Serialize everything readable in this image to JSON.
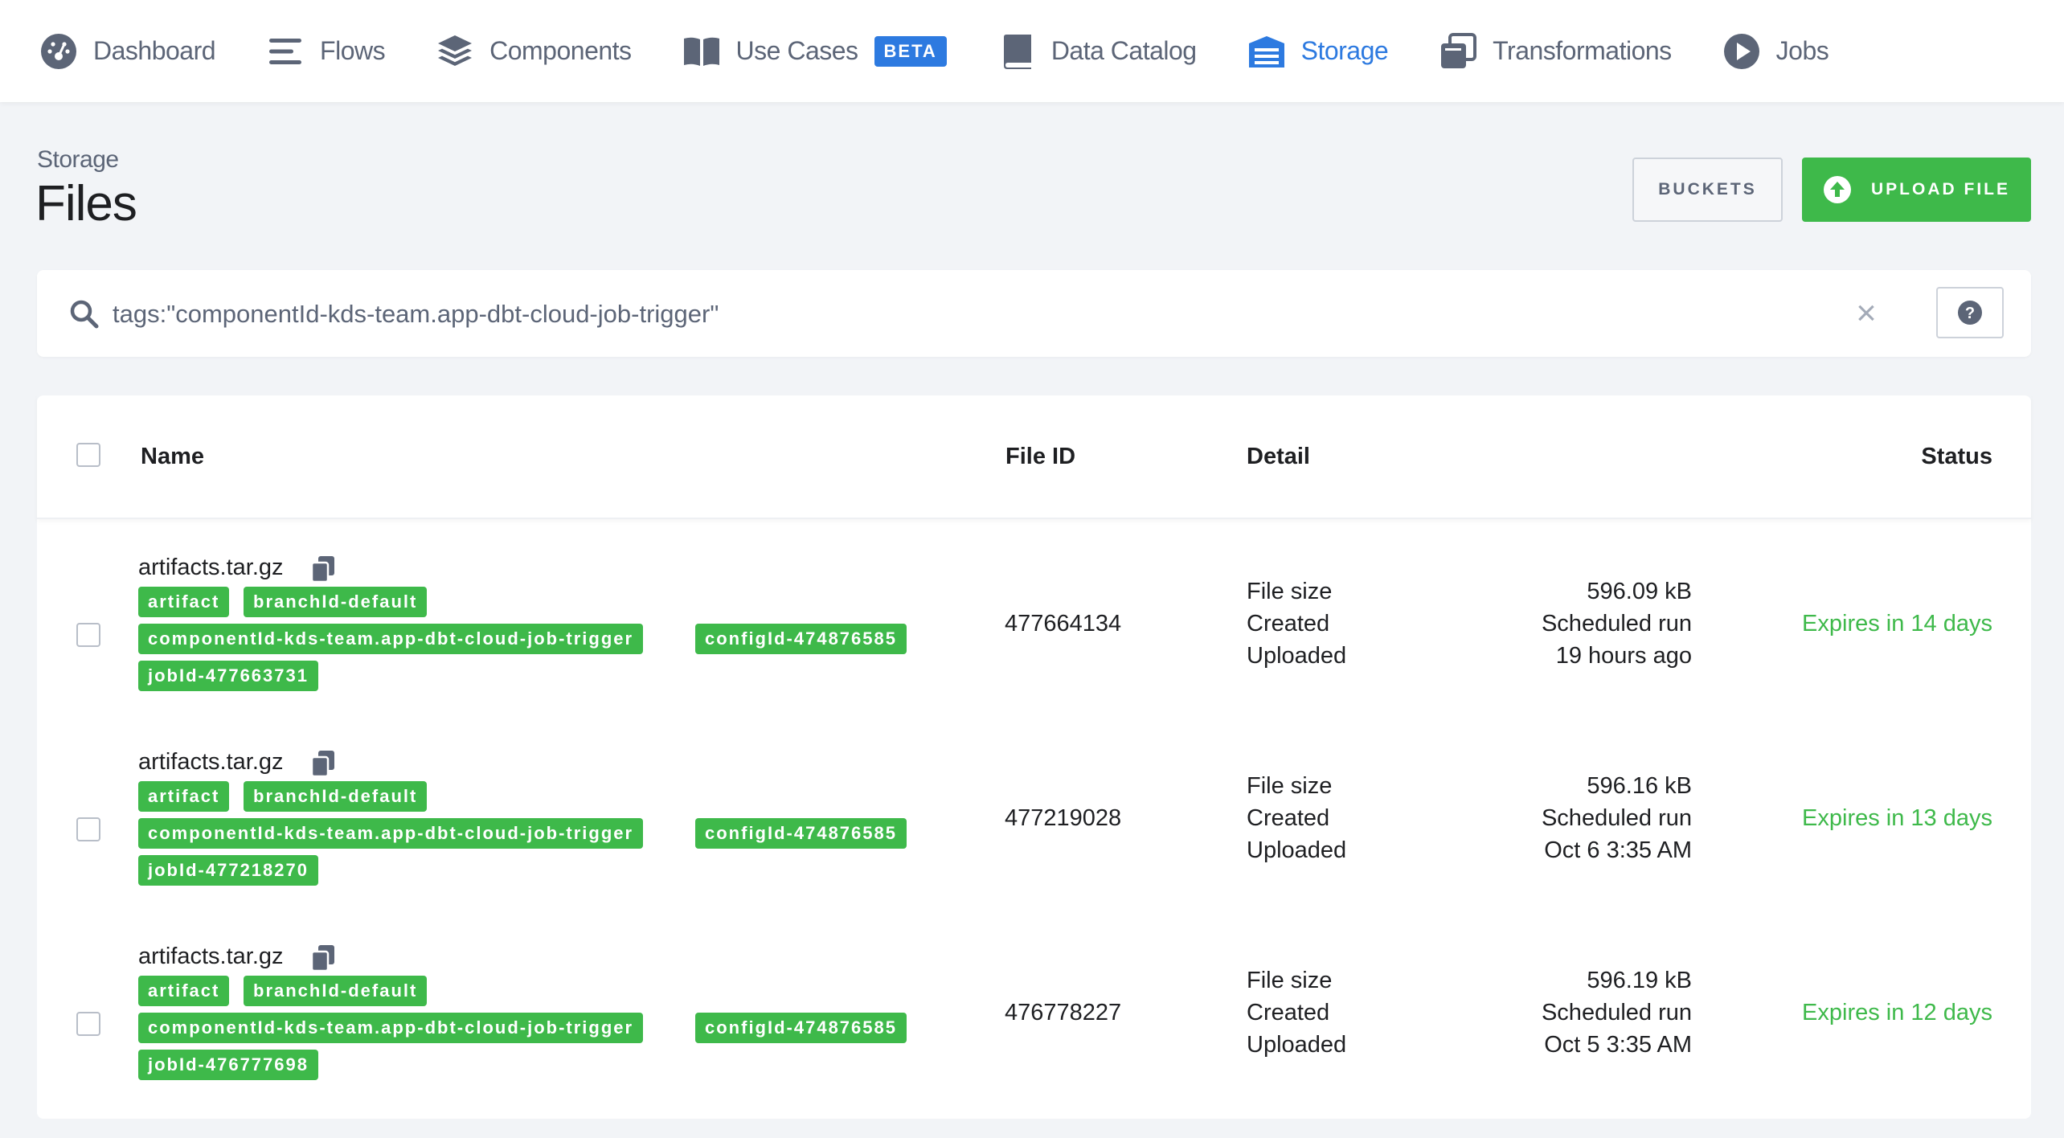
{
  "nav": {
    "items": [
      {
        "label": "Dashboard",
        "icon": "dashboard-icon"
      },
      {
        "label": "Flows",
        "icon": "flows-icon"
      },
      {
        "label": "Components",
        "icon": "components-icon"
      },
      {
        "label": "Use Cases",
        "icon": "use-cases-icon",
        "badge": "BETA"
      },
      {
        "label": "Data Catalog",
        "icon": "data-catalog-icon"
      },
      {
        "label": "Storage",
        "icon": "storage-icon",
        "active": true
      },
      {
        "label": "Transformations",
        "icon": "transformations-icon"
      },
      {
        "label": "Jobs",
        "icon": "jobs-icon"
      }
    ]
  },
  "header": {
    "breadcrumb": "Storage",
    "title": "Files",
    "buckets_label": "BUCKETS",
    "upload_label": "UPLOAD FILE"
  },
  "search": {
    "value": "tags:\"componentId-kds-team.app-dbt-cloud-job-trigger\""
  },
  "table": {
    "columns": {
      "name": "Name",
      "file_id": "File ID",
      "detail": "Detail",
      "status": "Status"
    },
    "rows": [
      {
        "name": "artifacts.tar.gz",
        "tags": [
          "artifact",
          "branchId-default",
          "componentId-kds-team.app-dbt-cloud-job-trigger",
          "configId-474876585",
          "jobId-477663731"
        ],
        "file_id": "477664134",
        "detail_labels": [
          "File size",
          "Created",
          "Uploaded"
        ],
        "detail_values": [
          "596.09 kB",
          "Scheduled run",
          "19 hours ago"
        ],
        "status": "Expires in 14 days"
      },
      {
        "name": "artifacts.tar.gz",
        "tags": [
          "artifact",
          "branchId-default",
          "componentId-kds-team.app-dbt-cloud-job-trigger",
          "configId-474876585",
          "jobId-477218270"
        ],
        "file_id": "477219028",
        "detail_labels": [
          "File size",
          "Created",
          "Uploaded"
        ],
        "detail_values": [
          "596.16 kB",
          "Scheduled run",
          "Oct 6 3:35 AM"
        ],
        "status": "Expires in 13 days"
      },
      {
        "name": "artifacts.tar.gz",
        "tags": [
          "artifact",
          "branchId-default",
          "componentId-kds-team.app-dbt-cloud-job-trigger",
          "configId-474876585",
          "jobId-476777698"
        ],
        "file_id": "476778227",
        "detail_labels": [
          "File size",
          "Created",
          "Uploaded"
        ],
        "detail_values": [
          "596.19 kB",
          "Scheduled run",
          "Oct 5 3:35 AM"
        ],
        "status": "Expires in 12 days"
      }
    ]
  },
  "colors": {
    "accent": "#2d7ae0",
    "success": "#3eb94a",
    "nav_text": "#5c6577"
  }
}
